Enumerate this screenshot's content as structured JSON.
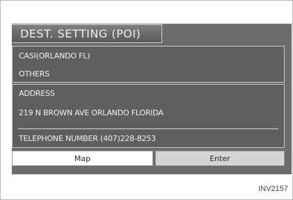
{
  "screen": {
    "title": "DEST. SETTING (POI)",
    "poi": {
      "category": "CASI(ORLANDO FL)",
      "subcategory": "OTHERS"
    },
    "address": {
      "label": "ADDRESS",
      "value": "219 N BROWN AVE ORLANDO FLORIDA",
      "telephone": "TELEPHONE NUMBER (407)228-8253"
    },
    "buttons": {
      "map": "Map",
      "enter": "Enter"
    }
  },
  "figure_code": "INV2157"
}
